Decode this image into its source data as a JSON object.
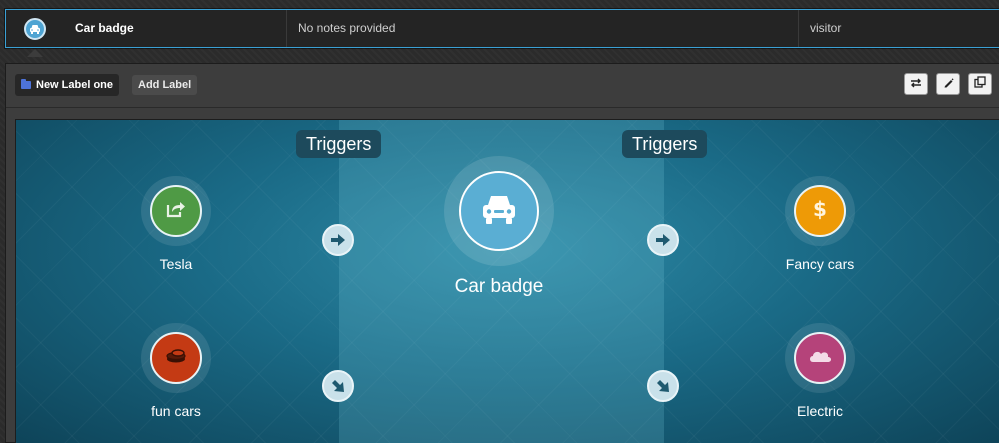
{
  "row": {
    "title": "Car badge",
    "notes": "No notes provided",
    "role": "visitor",
    "icon": "car-icon"
  },
  "toolbar": {
    "label_chip": "New Label one",
    "add_label": "Add Label",
    "buttons": [
      "swap-icon",
      "pencil-icon",
      "copy-icon"
    ]
  },
  "canvas": {
    "triggers_left": "Triggers",
    "triggers_right": "Triggers",
    "center": {
      "label": "Car badge",
      "icon": "car-icon",
      "color": "#5aaed3"
    },
    "left_nodes": [
      {
        "label": "Tesla",
        "icon": "share-icon",
        "color": "#4f9a45"
      },
      {
        "label": "fun cars",
        "icon": "coins-icon",
        "color": "#c43a14"
      }
    ],
    "right_nodes": [
      {
        "label": "Fancy cars",
        "icon": "dollar-icon",
        "color": "#ee9a06"
      },
      {
        "label": "Electric",
        "icon": "cloud-icon",
        "color": "#b5437a"
      }
    ]
  },
  "colors": {
    "accent": "#3aa0d4",
    "background": "#2b2b2b",
    "canvas": "#1a6a86"
  }
}
